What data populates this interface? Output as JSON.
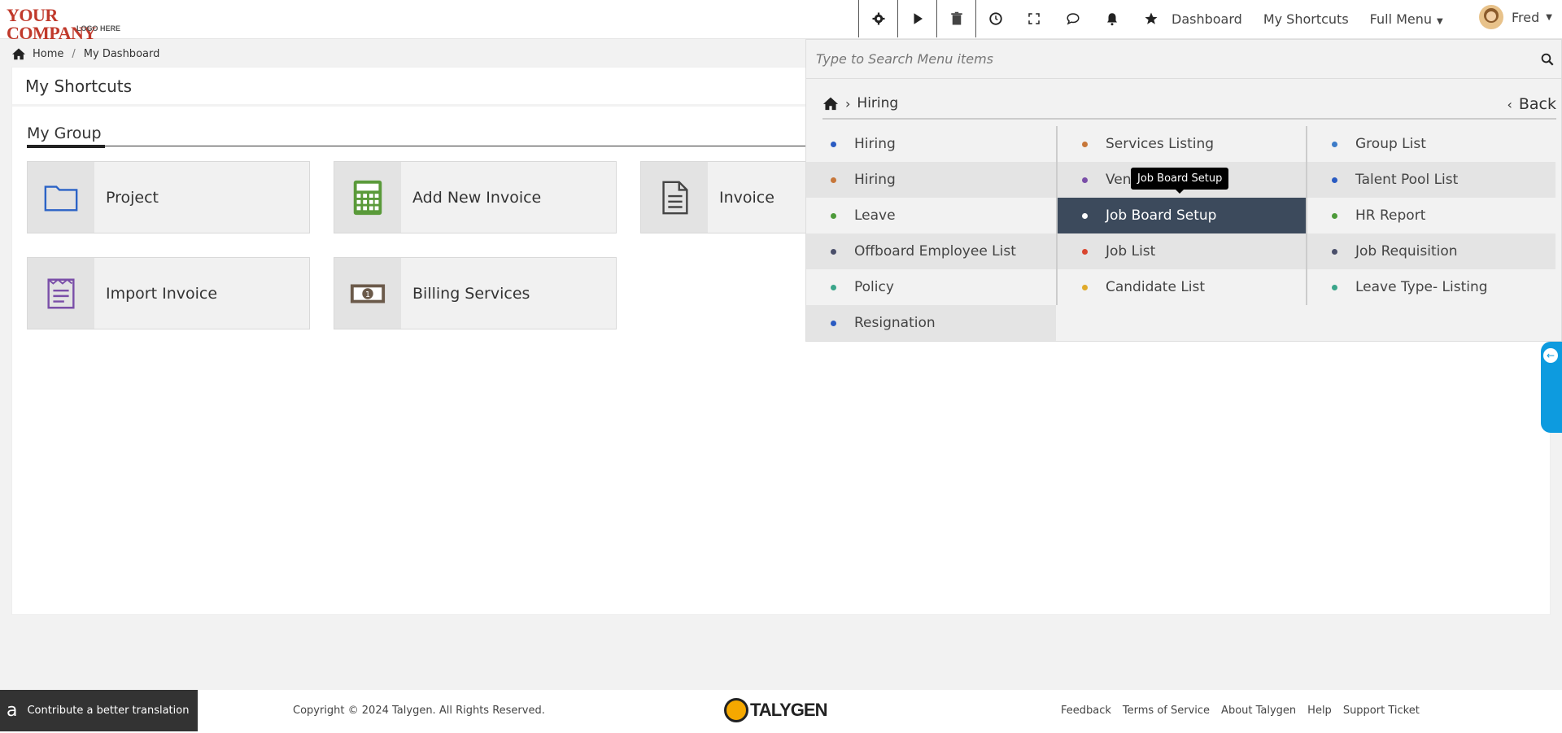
{
  "header": {
    "logo_line1": "YOUR COMPANY",
    "logo_line2": "LOGO HERE",
    "nav": [
      "Dashboard",
      "My Shortcuts",
      "Full Menu"
    ],
    "user_name": "Fred"
  },
  "breadcrumb": {
    "home": "Home",
    "current": "My Dashboard"
  },
  "panel": {
    "title": "My Shortcuts",
    "group_title": "My Group",
    "tiles": [
      {
        "label": "Project",
        "icon": "folder-icon"
      },
      {
        "label": "Add New Invoice",
        "icon": "calculator-icon"
      },
      {
        "label": "Invoice",
        "icon": "document-icon"
      },
      {
        "label": "Import Invoice",
        "icon": "import-invoice-icon"
      },
      {
        "label": "Billing Services",
        "icon": "banknote-icon"
      }
    ]
  },
  "menu": {
    "search_placeholder": "Type to Search Menu items",
    "crumb_current": "Hiring",
    "back_label": "Back",
    "tooltip": "Job Board Setup",
    "columns": [
      [
        {
          "label": "Hiring",
          "dot": "#2a5bc2"
        },
        {
          "label": "Hiring",
          "dot": "#c7773a"
        },
        {
          "label": "Leave",
          "dot": "#4d9a3a"
        },
        {
          "label": "Offboard Employee List",
          "dot": "#4a4f6a"
        },
        {
          "label": "Policy",
          "dot": "#3aa58a"
        },
        {
          "label": "Resignation",
          "dot": "#2a5bc2"
        }
      ],
      [
        {
          "label": "Services Listing",
          "dot": "#c7773a"
        },
        {
          "label": "Vendor",
          "dot": "#7a4ea8"
        },
        {
          "label": "Job Board Setup",
          "dot": "#ffffff"
        },
        {
          "label": "Job List",
          "dot": "#d9452e"
        },
        {
          "label": "Candidate List",
          "dot": "#e0aa2a"
        }
      ],
      [
        {
          "label": "Group List",
          "dot": "#3c7bc8"
        },
        {
          "label": "Talent Pool List",
          "dot": "#2a5bc2"
        },
        {
          "label": "HR Report",
          "dot": "#4d9a3a"
        },
        {
          "label": "Job Requisition",
          "dot": "#4a4f6a"
        },
        {
          "label": "Leave Type- Listing",
          "dot": "#3aa58a"
        }
      ]
    ]
  },
  "footer": {
    "translate": "Contribute a better translation",
    "copyright": "Copyright © 2024 Talygen. All Rights Reserved.",
    "brand": "TALYGEN",
    "links": [
      "Feedback",
      "Terms of Service",
      "About Talygen",
      "Help",
      "Support Ticket"
    ]
  },
  "colors": {
    "active_menu_bg": "#3c4a5c",
    "side_tab": "#0d9bdf",
    "logo_red": "#c0392b"
  }
}
